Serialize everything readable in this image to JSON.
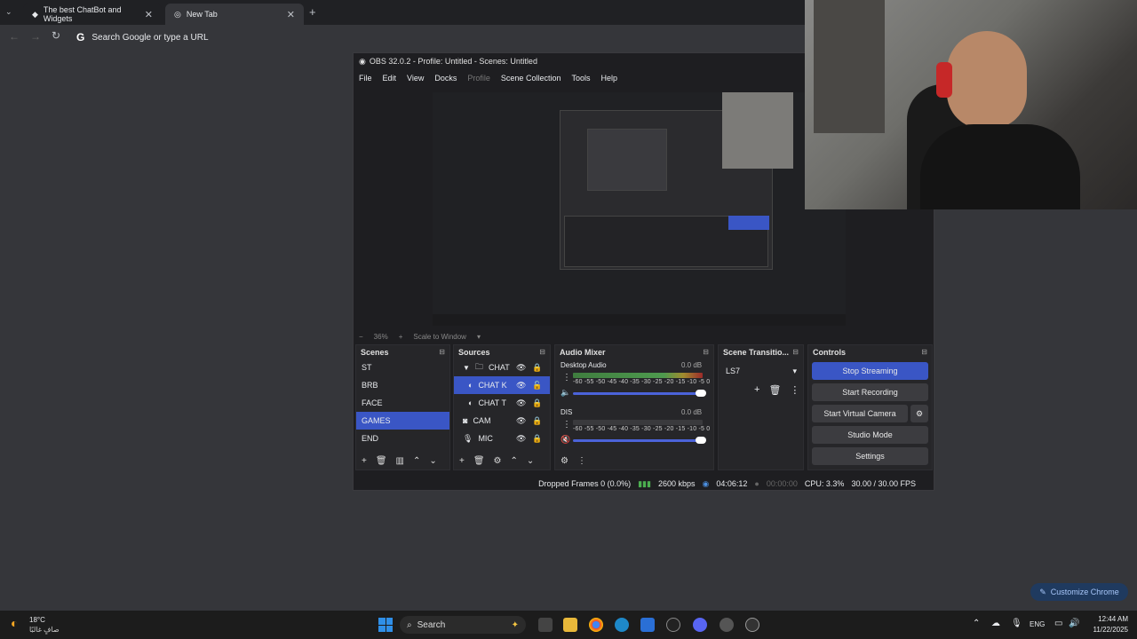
{
  "chrome": {
    "tabs": [
      {
        "label": "The best ChatBot and Widgets"
      },
      {
        "label": "New Tab"
      }
    ],
    "omnibox_placeholder": "Search Google or type a URL",
    "customize_label": "Customize Chrome"
  },
  "obs": {
    "title": "OBS 32.0.2 - Profile: Untitled - Scenes: Untitled",
    "menu": [
      "File",
      "Edit",
      "View",
      "Docks",
      "Profile",
      "Scene Collection",
      "Tools",
      "Help"
    ],
    "preview": {
      "zoom": "36%",
      "scale_label": "Scale to Window"
    },
    "scenes": {
      "title": "Scenes",
      "items": [
        "ST",
        "BRB",
        "FACE",
        "GAMES",
        "END"
      ],
      "selected": "GAMES"
    },
    "sources": {
      "title": "Sources",
      "items": [
        {
          "name": "CHAT",
          "icon": "folder-icon"
        },
        {
          "name": "CHAT K",
          "icon": "browser-icon"
        },
        {
          "name": "CHAT T",
          "icon": "browser-icon"
        },
        {
          "name": "CAM",
          "icon": "camera-icon"
        },
        {
          "name": "MIC",
          "icon": "mic-icon"
        }
      ]
    },
    "mixer": {
      "title": "Audio Mixer",
      "channels": [
        {
          "name": "Desktop Audio",
          "db": "0.0 dB"
        },
        {
          "name": "DIS",
          "db": "0.0 dB"
        }
      ],
      "ticks": "-60 -55 -50 -45 -40 -35 -30 -25 -20 -15 -10 -5 0"
    },
    "transitions": {
      "title": "Scene Transitio...",
      "selected": "LS7"
    },
    "controls": {
      "title": "Controls",
      "stop_streaming": "Stop Streaming",
      "start_recording": "Start Recording",
      "start_virtual_camera": "Start Virtual Camera",
      "studio_mode": "Studio Mode",
      "settings": "Settings"
    },
    "status": {
      "dropped": "Dropped Frames 0 (0.0%)",
      "bitrate": "2600 kbps",
      "stream_time": "04:06:12",
      "rec_time": "00:00:00",
      "cpu": "CPU: 3.3%",
      "fps": "30.00 / 30.00 FPS"
    }
  },
  "taskbar": {
    "weather_temp": "18°C",
    "weather_desc": "صافٍ غالبًا",
    "search": "Search",
    "lang": "ENG",
    "time": "12:44 AM",
    "date": "11/22/2025"
  },
  "colors": {
    "accent": "#3a56c5",
    "chrome_bg": "#35363a"
  }
}
